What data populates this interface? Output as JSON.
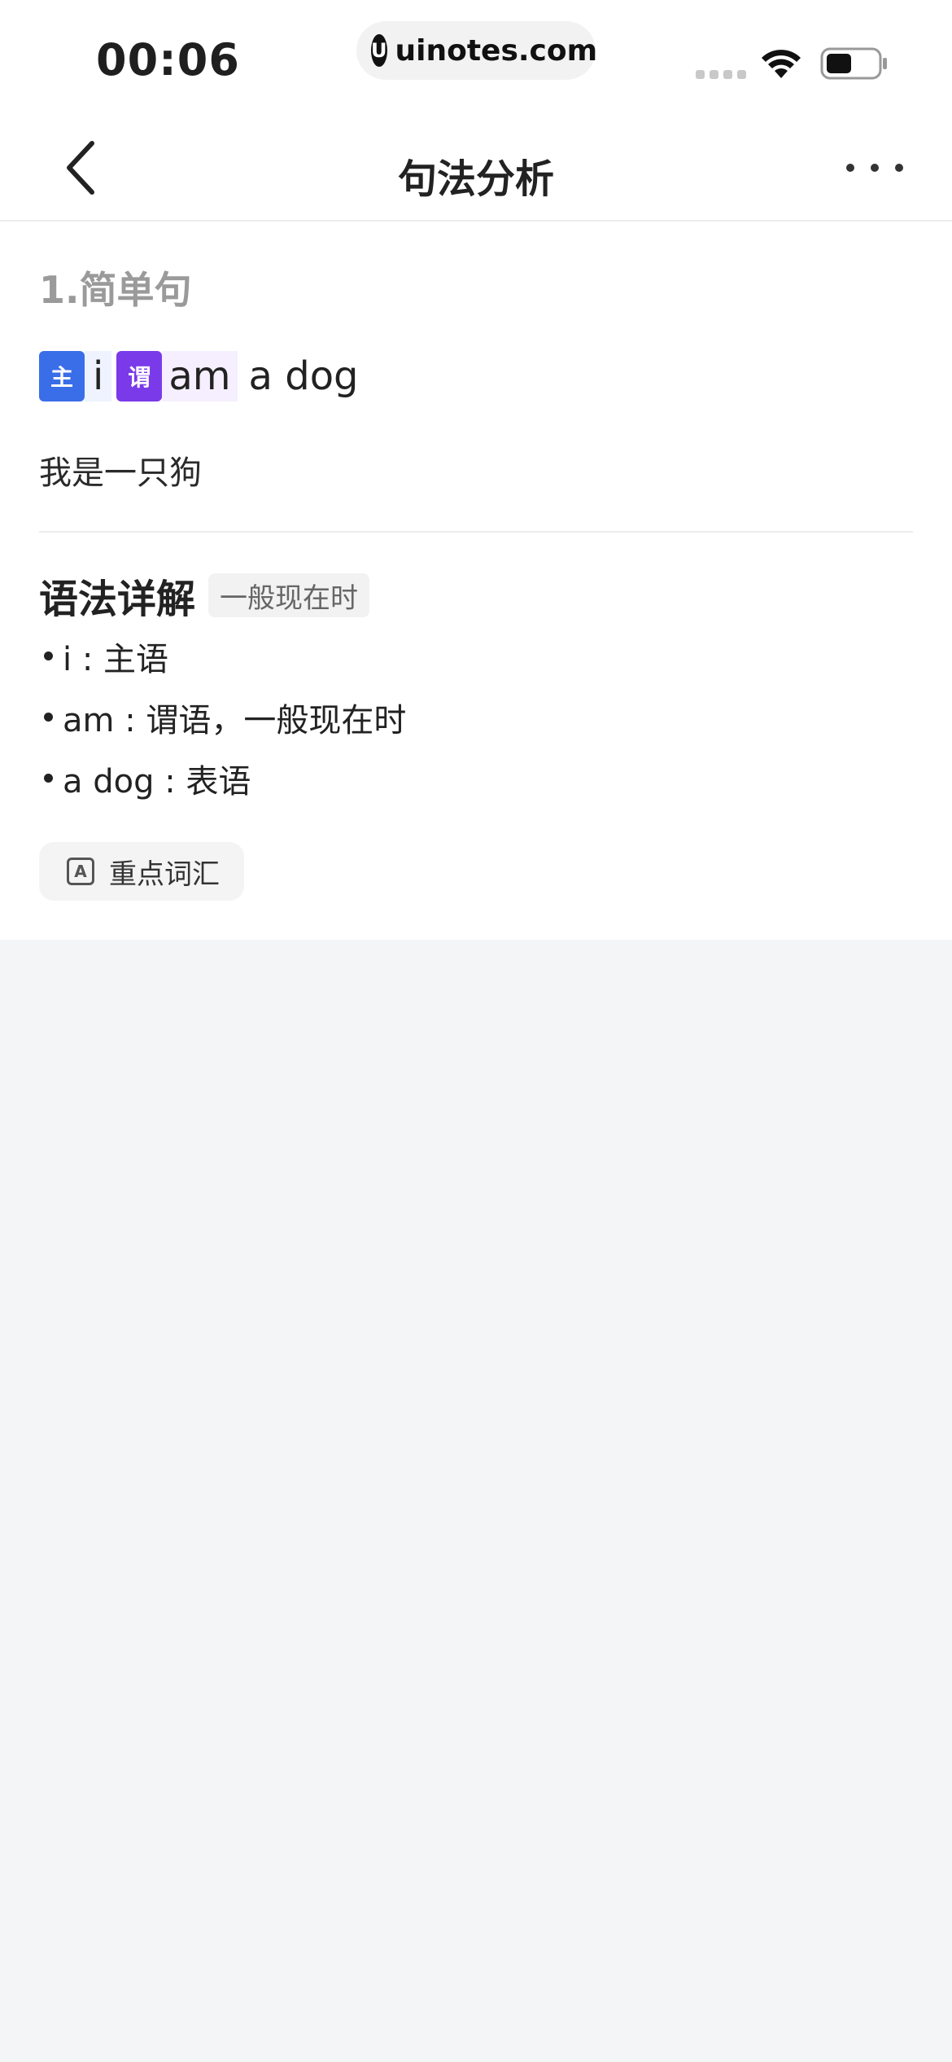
{
  "status_bar": {
    "time": "00:06",
    "url_logo": "U",
    "url": "uinotes.com",
    "icons": [
      "signal-icon",
      "wifi-icon",
      "battery-icon"
    ]
  },
  "nav": {
    "title": "句法分析",
    "icons": [
      "back-chevron-icon",
      "more-icon"
    ]
  },
  "sentence_section": {
    "heading": "1.简单句",
    "tags": [
      {
        "label": "主",
        "color": "#3a6ee8"
      },
      {
        "label": "谓",
        "color": "#7a3aea"
      }
    ],
    "subject_word": "i",
    "predicate_word": "am",
    "rest_words": "a dog",
    "translation": "我是一只狗"
  },
  "grammar": {
    "title": "语法详解",
    "tense_badge": "一般现在时",
    "items": [
      "i : 主语",
      "am : 谓语，一般现在时",
      "a dog : 表语"
    ]
  },
  "vocab_button": {
    "icon_glyph": "A",
    "label": "重点词汇"
  }
}
